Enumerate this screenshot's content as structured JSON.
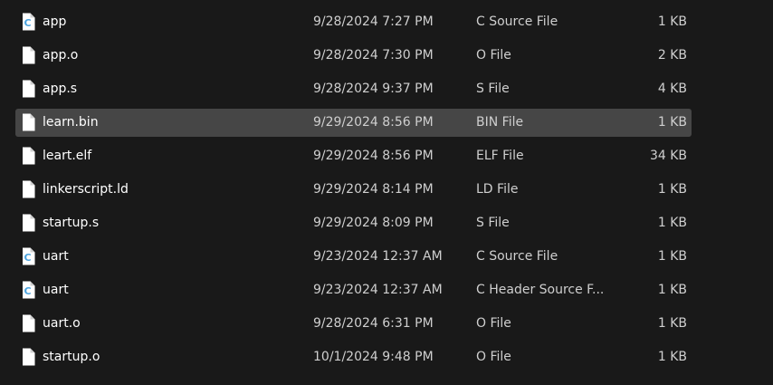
{
  "files": [
    {
      "name": "app",
      "date": "9/28/2024 7:27 PM",
      "type": "C Source File",
      "size": "1 KB",
      "icon": "c-source-file-icon",
      "selected": false
    },
    {
      "name": "app.o",
      "date": "9/28/2024 7:30 PM",
      "type": "O File",
      "size": "2 KB",
      "icon": "blank-file-icon",
      "selected": false
    },
    {
      "name": "app.s",
      "date": "9/28/2024 9:37 PM",
      "type": "S File",
      "size": "4 KB",
      "icon": "blank-file-icon",
      "selected": false
    },
    {
      "name": "learn.bin",
      "date": "9/29/2024 8:56 PM",
      "type": "BIN File",
      "size": "1 KB",
      "icon": "blank-file-icon",
      "selected": true
    },
    {
      "name": "leart.elf",
      "date": "9/29/2024 8:56 PM",
      "type": "ELF File",
      "size": "34 KB",
      "icon": "blank-file-icon",
      "selected": false
    },
    {
      "name": "linkerscript.ld",
      "date": "9/29/2024 8:14 PM",
      "type": "LD File",
      "size": "1 KB",
      "icon": "blank-file-icon",
      "selected": false
    },
    {
      "name": "startup.s",
      "date": "9/29/2024 8:09 PM",
      "type": "S File",
      "size": "1 KB",
      "icon": "blank-file-icon",
      "selected": false
    },
    {
      "name": "uart",
      "date": "9/23/2024 12:37 AM",
      "type": "C Source File",
      "size": "1 KB",
      "icon": "c-source-file-icon",
      "selected": false
    },
    {
      "name": "uart",
      "date": "9/23/2024 12:37 AM",
      "type": "C Header Source F...",
      "size": "1 KB",
      "icon": "c-header-file-icon",
      "selected": false
    },
    {
      "name": "uart.o",
      "date": "9/28/2024 6:31 PM",
      "type": "O File",
      "size": "1 KB",
      "icon": "blank-file-icon",
      "selected": false
    },
    {
      "name": "startup.o",
      "date": "10/1/2024 9:48 PM",
      "type": "O File",
      "size": "1 KB",
      "icon": "blank-file-icon",
      "selected": false
    }
  ],
  "colors": {
    "background": "#191919",
    "selection": "#464646",
    "c_icon_accent": "#4aa3df"
  }
}
